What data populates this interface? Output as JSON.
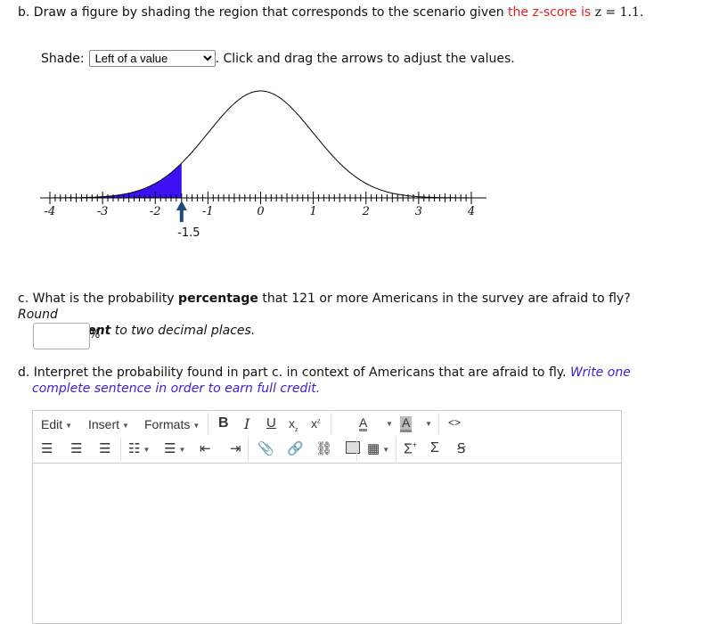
{
  "part_b": {
    "prefix": "b. Draw a figure by shading the region that corresponds to the scenario given ",
    "highlight": "the z-score is ",
    "z_math": "z = 1.1.",
    "shade_label": "Shade:",
    "shade_selected": "Left of a value",
    "instructions": ". Click and drag the arrows to adjust the values."
  },
  "plot": {
    "x_range": [
      -4,
      4
    ],
    "tick_labels": [
      "-4",
      "-3",
      "-2",
      "-1",
      "0",
      "1",
      "2",
      "3",
      "4"
    ],
    "shade_direction": "left",
    "shade_value": -1.5,
    "handle_label": "-1.5",
    "shade_color": "#3d10f5",
    "handle_color": "#1f4a7e"
  },
  "part_c": {
    "text1": "c. What is the probability ",
    "bold1": "percentage",
    "text2": " that 121 or more Americans in the survey are afraid to fly? ",
    "italic1": "Round",
    "italic2a": "the ",
    "bold_italic": "percent",
    "italic2b": " to two decimal places.",
    "answer_value": "",
    "unit": "%"
  },
  "part_d": {
    "text1": "d. Interpret the probability found in part c. in context of Americans that are afraid to fly. ",
    "blue1": "Write one",
    "blue2": "complete sentence in order to earn full credit."
  },
  "editor": {
    "menus": [
      "Edit",
      "Insert",
      "Formats"
    ],
    "row1_icons": [
      "bold-icon",
      "italic-icon",
      "underline-icon",
      "subscript-icon",
      "superscript-icon",
      "text-color-icon",
      "background-color-icon",
      "source-code-icon"
    ],
    "row2_icons": [
      "align-left-icon",
      "align-center-icon",
      "align-right-icon",
      "bullet-list-icon",
      "numbered-list-icon",
      "outdent-icon",
      "indent-icon",
      "attachment-icon",
      "link-icon",
      "unlink-icon",
      "image-icon",
      "table-icon",
      "sum-plus-icon",
      "sum-icon",
      "special-char-icon"
    ],
    "content": ""
  }
}
